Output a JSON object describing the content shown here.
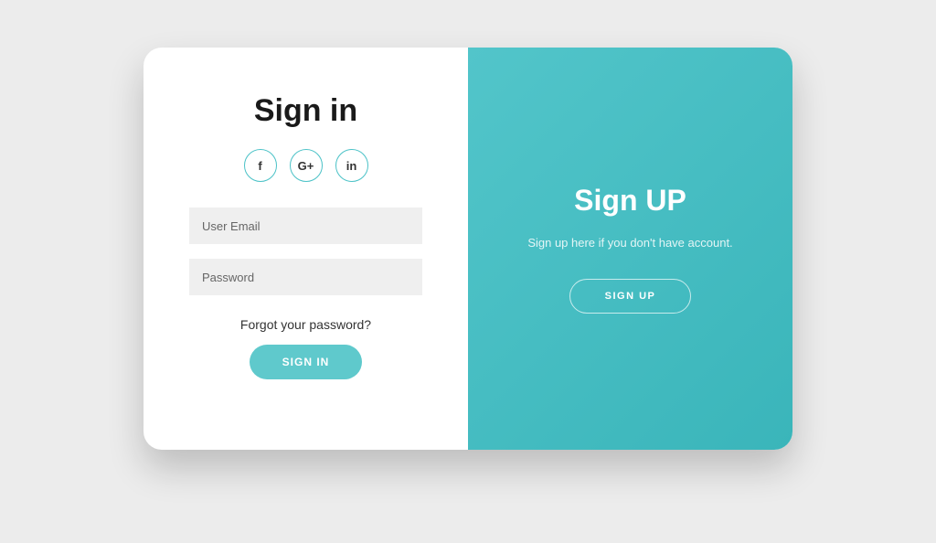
{
  "signin": {
    "title": "Sign in",
    "emailPlaceholder": "User Email",
    "passwordPlaceholder": "Password",
    "forgotText": "Forgot your password?",
    "buttonLabel": "SIGN IN"
  },
  "signup": {
    "title": "Sign UP",
    "subtitle": "Sign up here if you don't have account.",
    "buttonLabel": "SIGN UP"
  },
  "social": {
    "facebook": "f",
    "google": "G+",
    "linkedin": "in"
  }
}
